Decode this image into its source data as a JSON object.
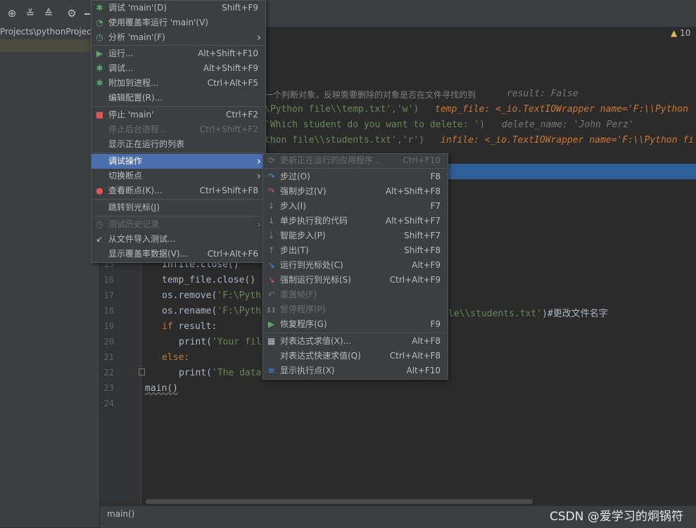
{
  "project": {
    "path": "Projects\\pythonProject"
  },
  "inspections": {
    "warnings": "10"
  },
  "editor": {
    "line_numbers": [
      "15",
      "16",
      "17",
      "18",
      "19",
      "20",
      "21",
      "22",
      "23",
      "24"
    ],
    "lines": {
      "l_comment": "一个判断对象，反映需要删除的对象是否在文件寻找的到",
      "l_hint_result": "result: False",
      "l_temp_a": "\\Python file\\\\temp.txt','w')",
      "l_hint_temp": "temp_file: <_io.TextIOWrapper name='F:\\\\Python",
      "l_input": "'Which student do you want to delete: ')",
      "l_hint_del": "delete_name: 'John Perz'",
      "l_infile": "thon file\\\\students.txt','r')",
      "l_hint_infile": "infile: <_io.TextIOWrapper name='F:\\\\Python fi",
      "l15": "infile.close()",
      "l16": "temp_file.close()",
      "l17a": "os.remove(",
      "l17b": "'F:\\Pyth",
      "l18a": "os.rename(",
      "l18b": "'F:\\Pyth",
      "l18c": "le\\\\students.txt'",
      "l18d": ")#更改文件名字",
      "l19a": "if",
      "l19b": " result:",
      "l20a": "print(",
      "l20b": "'Your fil",
      "l21": "else:",
      "l22a": "print(",
      "l22b": "'The data",
      "l23": "main()"
    }
  },
  "status": {
    "breadcrumb": "main()"
  },
  "watermark": "CSDN @爱学习的炯锅符",
  "run_menu": [
    {
      "label": "调试 'main'(D)",
      "shortcut": "Shift+F9",
      "icon": "debug-bug-icon"
    },
    {
      "label": "使用覆盖率运行 'main'(V)",
      "shortcut": "",
      "icon": "coverage-icon"
    },
    {
      "label": "分析 'main'(F)",
      "shortcut": "",
      "icon": "profile-icon",
      "submenu": true
    },
    {
      "label": "运行...",
      "shortcut": "Alt+Shift+F10",
      "icon": "run-icon"
    },
    {
      "label": "调试...",
      "shortcut": "Alt+Shift+F9",
      "icon": "debug-bug-icon"
    },
    {
      "label": "附加到进程...",
      "shortcut": "Ctrl+Alt+F5",
      "icon": "attach-process-icon"
    },
    {
      "label": "编辑配置(R)...",
      "shortcut": "",
      "icon": ""
    },
    {
      "label": "停止 'main'",
      "shortcut": "Ctrl+F2",
      "icon": "stop-icon"
    },
    {
      "label": "停止后台进程...",
      "shortcut": "Ctrl+Shift+F2",
      "icon": "",
      "disabled": true
    },
    {
      "label": "显示正在运行的列表",
      "shortcut": "",
      "icon": ""
    },
    {
      "label": "调试操作",
      "shortcut": "",
      "icon": "",
      "submenu": true,
      "selected": true
    },
    {
      "label": "切换断点",
      "shortcut": "",
      "icon": "",
      "submenu": true
    },
    {
      "label": "查看断点(K)...",
      "shortcut": "Ctrl+Shift+F8",
      "icon": "breakpoints-icon"
    },
    {
      "label": "跳转到光标(J)",
      "shortcut": "",
      "icon": ""
    },
    {
      "label": "测试历史记录",
      "shortcut": "",
      "icon": "history-icon",
      "disabled": true,
      "submenu": true
    },
    {
      "label": "从文件导入测试...",
      "shortcut": "",
      "icon": "import-tests-icon"
    },
    {
      "label": "显示覆盖率数据(V)...",
      "shortcut": "Ctrl+Alt+F6",
      "icon": ""
    }
  ],
  "debug_menu": [
    {
      "label": "更新正在运行的应用程序...",
      "shortcut": "Ctrl+F10",
      "icon": "update-icon",
      "disabled": true
    },
    {
      "label": "步过(O)",
      "shortcut": "F8",
      "icon": "step-over-icon"
    },
    {
      "label": "强制步过(V)",
      "shortcut": "Alt+Shift+F8",
      "icon": "force-step-over-icon"
    },
    {
      "label": "步入(I)",
      "shortcut": "F7",
      "icon": "step-into-icon"
    },
    {
      "label": "单步执行我的代码",
      "shortcut": "Alt+Shift+F7",
      "icon": "step-into-my-code-icon"
    },
    {
      "label": "智能步入(P)",
      "shortcut": "Shift+F7",
      "icon": "smart-step-into-icon"
    },
    {
      "label": "步出(T)",
      "shortcut": "Shift+F8",
      "icon": "step-out-icon"
    },
    {
      "label": "运行到光标处(C)",
      "shortcut": "Alt+F9",
      "icon": "run-to-cursor-icon"
    },
    {
      "label": "强制运行到光标(S)",
      "shortcut": "Ctrl+Alt+F9",
      "icon": "force-run-to-cursor-icon"
    },
    {
      "label": "重置帧(F)",
      "shortcut": "",
      "icon": "reset-frame-icon",
      "disabled": true
    },
    {
      "label": "暂停程序(P)",
      "shortcut": "",
      "icon": "pause-icon",
      "disabled": true
    },
    {
      "label": "恢复程序(G)",
      "shortcut": "F9",
      "icon": "resume-icon"
    },
    {
      "label": "对表达式求值(X)...",
      "shortcut": "Alt+F8",
      "icon": "evaluate-icon"
    },
    {
      "label": "对表达式快速求值(Q)",
      "shortcut": "Ctrl+Alt+F8",
      "icon": ""
    },
    {
      "label": "显示执行点(X)",
      "shortcut": "Alt+F10",
      "icon": "show-execution-point-icon"
    }
  ],
  "colors": {
    "accent": "#4b6eaf",
    "exec_line": "#2d5f9a",
    "keyword": "#cc7832",
    "string": "#6a8759",
    "run_green": "#59a869",
    "stop_red": "#e55353"
  }
}
